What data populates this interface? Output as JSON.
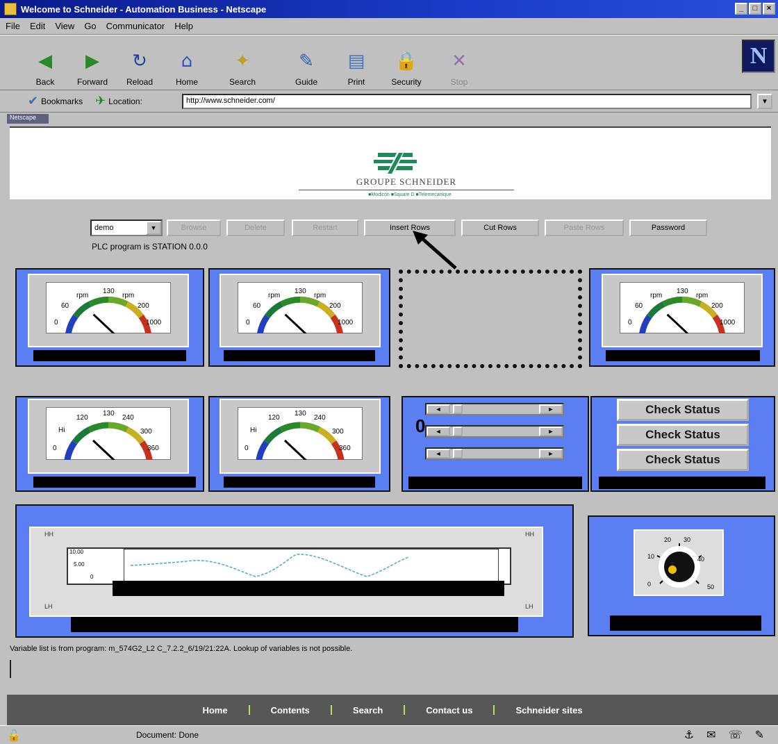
{
  "window": {
    "title": "Welcome to Schneider - Automation Business - Netscape",
    "min": "_",
    "max": "□",
    "close": "×"
  },
  "menu": [
    "File",
    "Edit",
    "View",
    "Go",
    "Communicator",
    "Help"
  ],
  "toolbar": {
    "buttons": [
      {
        "label": "Back",
        "icon": "back-arrow-icon"
      },
      {
        "label": "Forward",
        "icon": "forward-arrow-icon"
      },
      {
        "label": "Reload",
        "icon": "reload-icon"
      },
      {
        "label": "Home",
        "icon": "home-icon"
      },
      {
        "label": "Search",
        "icon": "search-icon"
      },
      {
        "label": "Guide",
        "icon": "guide-icon"
      },
      {
        "label": "Print",
        "icon": "print-icon"
      },
      {
        "label": "Security",
        "icon": "security-icon"
      },
      {
        "label": "Stop",
        "icon": "stop-icon"
      }
    ],
    "brand_glyph": "N"
  },
  "locationbar": {
    "bookmarks_label": "Bookmarks",
    "location_label": "Location:",
    "url": "http://www.schneider.com/"
  },
  "tab_marker": "Netscape",
  "header": {
    "brand_name": "GROUPE SCHNEIDER",
    "brand_sub": "■Modicon ■Square D ■Telemecanique"
  },
  "controls": {
    "select_value": "demo",
    "buttons": [
      {
        "label": "Browse",
        "disabled": true
      },
      {
        "label": "Delete",
        "disabled": true
      },
      {
        "label": "Restart",
        "disabled": true
      },
      {
        "label": "Insert Rows",
        "disabled": false
      },
      {
        "label": "Cut Rows",
        "disabled": false
      },
      {
        "label": "Paste Rows",
        "disabled": true
      },
      {
        "label": "Password",
        "disabled": false
      }
    ],
    "plc_text": "PLC program is STATION 0.0.0"
  },
  "gauges_row1": {
    "labels": {
      "top": "130",
      "left_mid": "60",
      "right_mid": "200",
      "left_low": "0",
      "right_low": "1000",
      "tl": "rpm",
      "tr": "rpm"
    }
  },
  "gauges_row2": {
    "labels": {
      "top": "130",
      "left_top": "120",
      "right_top": "240",
      "left_mid": "Hi",
      "right_mid": "300",
      "left_low": "0",
      "right_low": "360"
    }
  },
  "sliders": {
    "value_label": "0",
    "left_arrow": "◄",
    "right_arrow": "►"
  },
  "check_status": [
    "Check Status",
    "Check Status",
    "Check Status"
  ],
  "trend": {
    "corner_tl": "HH",
    "corner_tr": "HH",
    "corner_bl": "LH",
    "corner_br": "LH",
    "y_ticks": [
      "10.00",
      "5.00",
      "0"
    ]
  },
  "knob": {
    "labels": [
      "20",
      "30",
      "10",
      "40",
      "0",
      "50"
    ]
  },
  "status_line": "Variable list is from program:  m_574G2_L2 C_7.2.2_6/19/21:22A.  Lookup of variables is not possible.",
  "footer": [
    "Home",
    "Contents",
    "Search",
    "Contact us",
    "Schneider sites"
  ],
  "statusbar": {
    "text": "Document: Done"
  }
}
